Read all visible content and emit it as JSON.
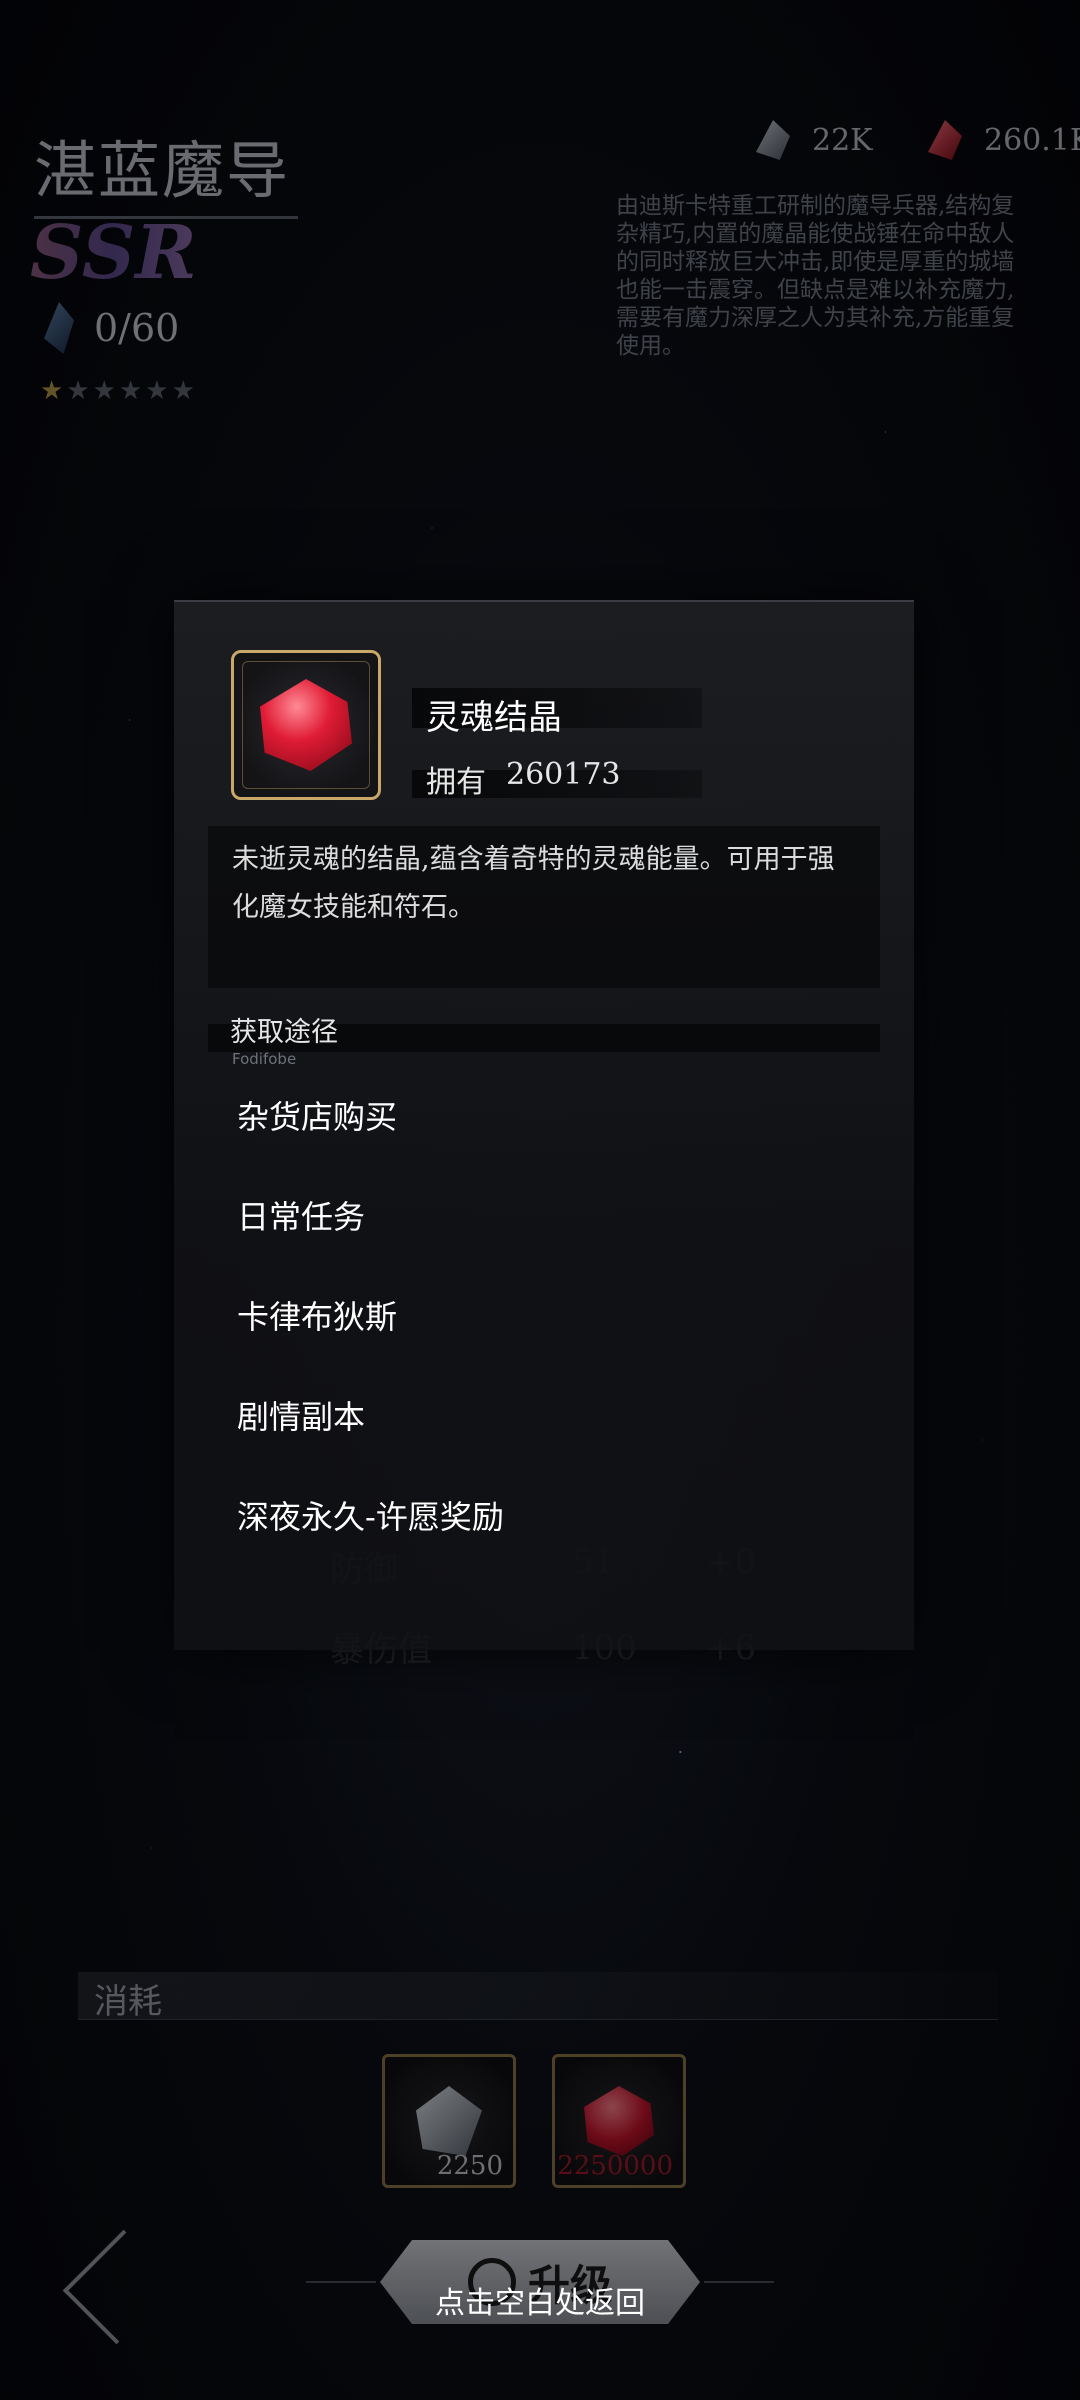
{
  "header": {
    "title": "湛蓝魔导",
    "rarity": "SSR",
    "shards": "0/60",
    "stars": [
      "★",
      "★",
      "★",
      "★",
      "★",
      "★"
    ],
    "lore": "由迪斯卡特重工研制的魔导兵器,结构复杂精巧,内置的魔晶能使战锤在命中敌人的同时释放巨大冲击,即使是厚重的城墙也能一击震穿。但缺点是难以补充魔力,需要有魔力深厚之人为其补充,方能重复使用。"
  },
  "currencies": [
    {
      "icon": "gray-crystal-icon",
      "amount": "22K"
    },
    {
      "icon": "red-crystal-icon",
      "amount": "260.1K"
    }
  ],
  "background_stats": [
    {
      "label": "防御",
      "current": "51",
      "delta": "+0"
    },
    {
      "label": "暴伤值",
      "current": "100",
      "delta": "+6"
    }
  ],
  "popup": {
    "item_name": "灵魂结晶",
    "owned_label": "拥有",
    "owned_count": "260173",
    "description": "未逝灵魂的结晶,蕴含着奇特的灵魂能量。可用于强化魔女技能和符石。",
    "source_title": "获取途径",
    "source_subtitle": "Fodifobe",
    "sources": [
      "杂货店购买",
      "日常任务",
      "卡律布狄斯",
      "剧情副本",
      "深夜永久-许愿奖励"
    ]
  },
  "consume": {
    "label": "消耗",
    "items": [
      {
        "icon": "gray-crystal-icon",
        "count": "2250"
      },
      {
        "icon": "red-crystal-icon",
        "count": "2250000"
      }
    ]
  },
  "upgrade_label": "升级",
  "return_hint": "点击空白处返回",
  "colors": {
    "gold_frame": "#c9a86a",
    "insufficient": "#a11a2c"
  }
}
